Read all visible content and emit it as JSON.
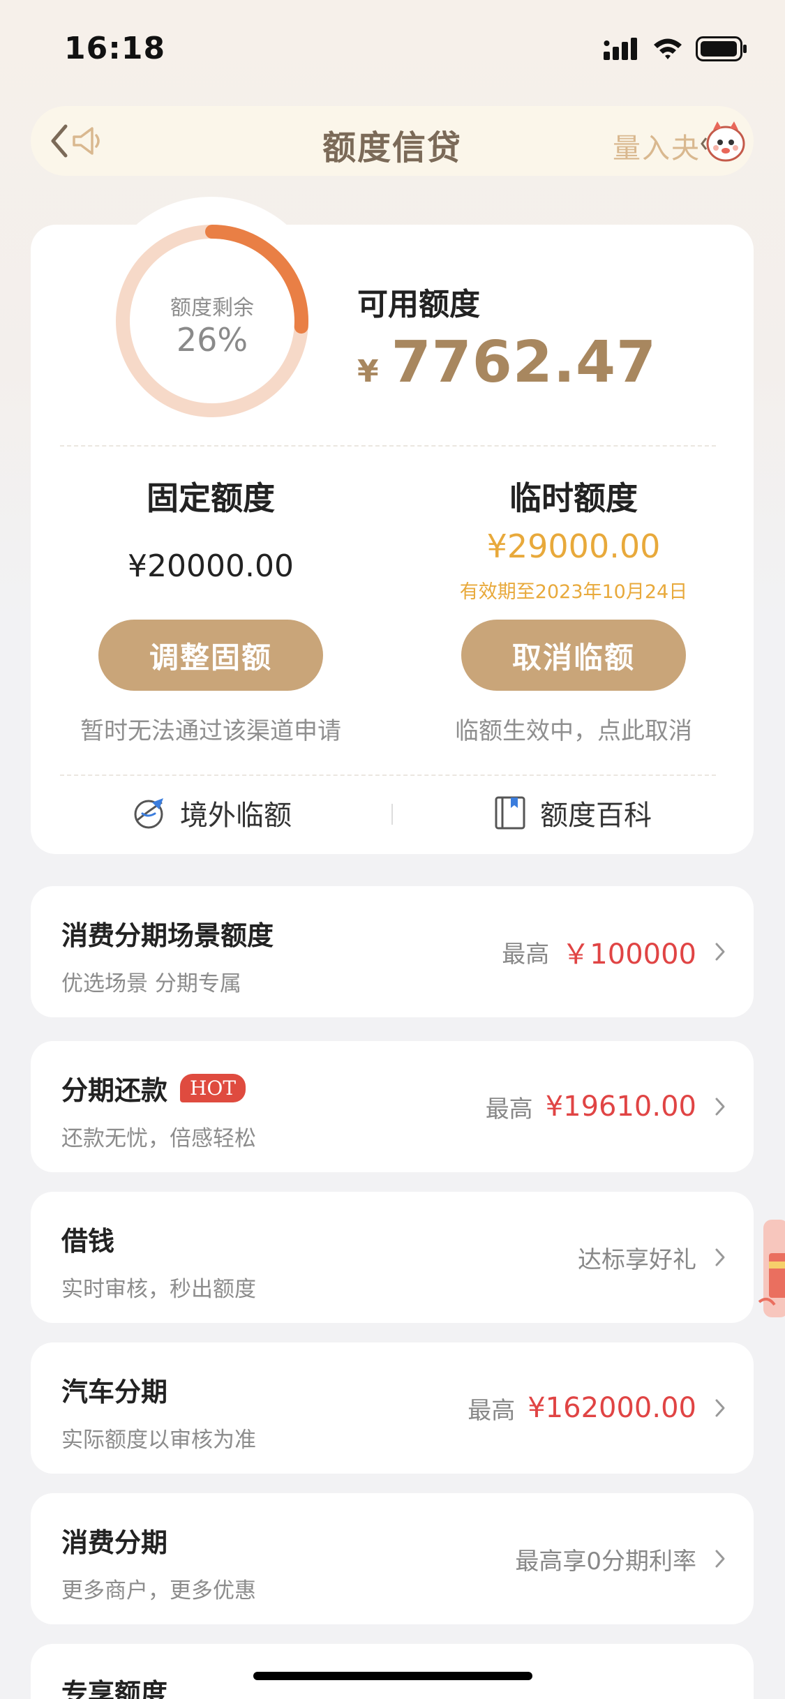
{
  "status_bar": {
    "time": "16:18"
  },
  "nav": {
    "title": "额度信贷",
    "marquee_text": "量入夬"
  },
  "summary": {
    "ring_label": "额度剩余",
    "ring_percent_text": "26%",
    "ring_fraction": 0.26,
    "available_label": "可用额度",
    "available_currency": "¥",
    "available_amount": "7762.47",
    "fixed": {
      "title": "固定额度",
      "amount": "¥20000.00",
      "button": "调整固额",
      "hint": "暂时无法通过该渠道申请"
    },
    "temporary": {
      "title": "临时额度",
      "amount": "¥29000.00",
      "expiry": "有效期至2023年10月24日",
      "button": "取消临额",
      "hint": "临额生效中，点此取消"
    },
    "links": {
      "overseas": "境外临额",
      "wiki": "额度百科"
    }
  },
  "list": [
    {
      "title": "消费分期场景额度",
      "subtitle": "优选场景 分期专属",
      "prefix": "最高",
      "value": "￥100000",
      "text": ""
    },
    {
      "title": "分期还款",
      "badge": "HOT",
      "subtitle": "还款无忧，倍感轻松",
      "prefix": "最高",
      "value": "¥19610.00",
      "text": ""
    },
    {
      "title": "借钱",
      "subtitle": "实时审核，秒出额度",
      "prefix": "",
      "value": "",
      "text": "达标享好礼"
    },
    {
      "title": "汽车分期",
      "subtitle": "实际额度以审核为准",
      "prefix": "最高",
      "value": "¥162000.00",
      "text": ""
    },
    {
      "title": "消费分期",
      "subtitle": "更多商户，更多优惠",
      "prefix": "",
      "value": "",
      "text": "最高享0分期利率"
    },
    {
      "title": "专享额度",
      "subtitle": "",
      "prefix": "",
      "value": "",
      "text": ""
    }
  ],
  "colors": {
    "accent_gold": "#c9a579",
    "amount_brown": "#a8875f",
    "temp_amount_orange": "#e8a93b",
    "value_red": "#e04444",
    "ring_track": "#f6d9c8",
    "ring_progress": "#e97f45",
    "hot_badge": "#df4b3f"
  },
  "icons": [
    "signal-icon",
    "wifi-icon",
    "battery-icon",
    "back-arrow-icon",
    "speaker-icon",
    "mascot-icon",
    "globe-plane-icon",
    "book-icon",
    "chevron-right-icon",
    "gift-icon"
  ]
}
